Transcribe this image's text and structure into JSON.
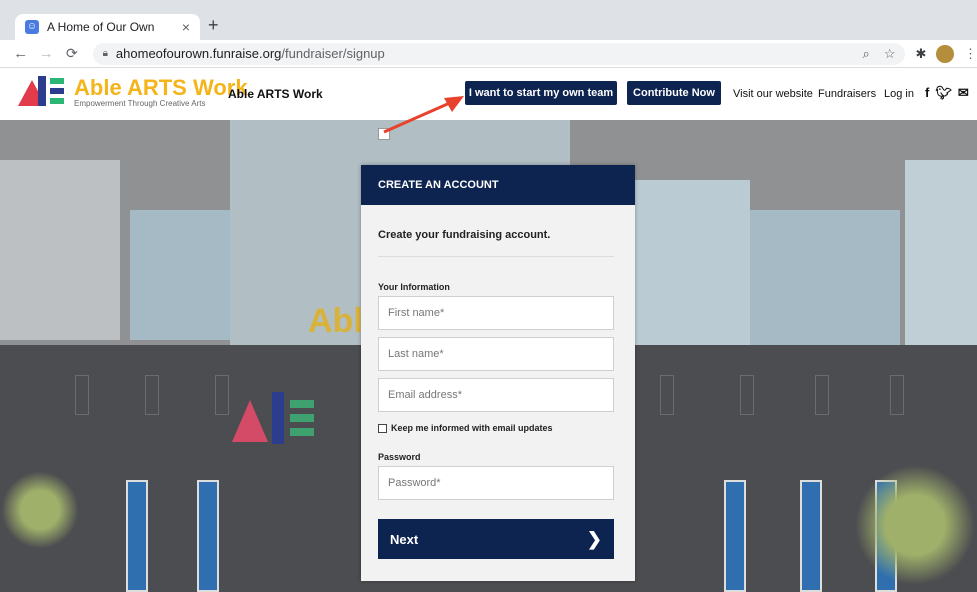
{
  "browser": {
    "tab_title": "A Home of Our Own",
    "tab_close": "×",
    "new_tab": "+",
    "url_domain": "ahomeofourown.funraise.org",
    "url_path": "/fundraiser/signup",
    "icons": [
      "back-icon",
      "forward-icon",
      "reload-icon",
      "lock-icon",
      "zoom-icon",
      "star-icon",
      "extensions-icon",
      "profile-avatar",
      "menu-icon"
    ]
  },
  "site": {
    "logo_name": "Able ARTS Work",
    "logo_tagline": "Empowerment Through Creative Arts",
    "org_name": "Able ARTS Work",
    "start_team_label": "I want to start my own team",
    "contribute_label": "Contribute Now",
    "nav": {
      "visit": "Visit our website",
      "fundraisers": "Fundraisers",
      "login": "Log in"
    },
    "social": [
      "facebook-icon",
      "twitter-icon",
      "email-icon"
    ]
  },
  "hero": {
    "sign_text": "Abl"
  },
  "form": {
    "header": "CREATE AN ACCOUNT",
    "subtitle": "Create your fundraising account.",
    "info_label": "Your Information",
    "first_name_placeholder": "First name*",
    "last_name_placeholder": "Last name*",
    "email_placeholder": "Email address*",
    "keep_informed_label": "Keep me informed with email updates",
    "keep_informed_checked": false,
    "password_label": "Password",
    "password_placeholder": "Password*",
    "next_label": "Next"
  },
  "colors": {
    "navy": "#0d2350",
    "logo_gold": "#f4b41a",
    "annotation_arrow": "#e8412c"
  }
}
